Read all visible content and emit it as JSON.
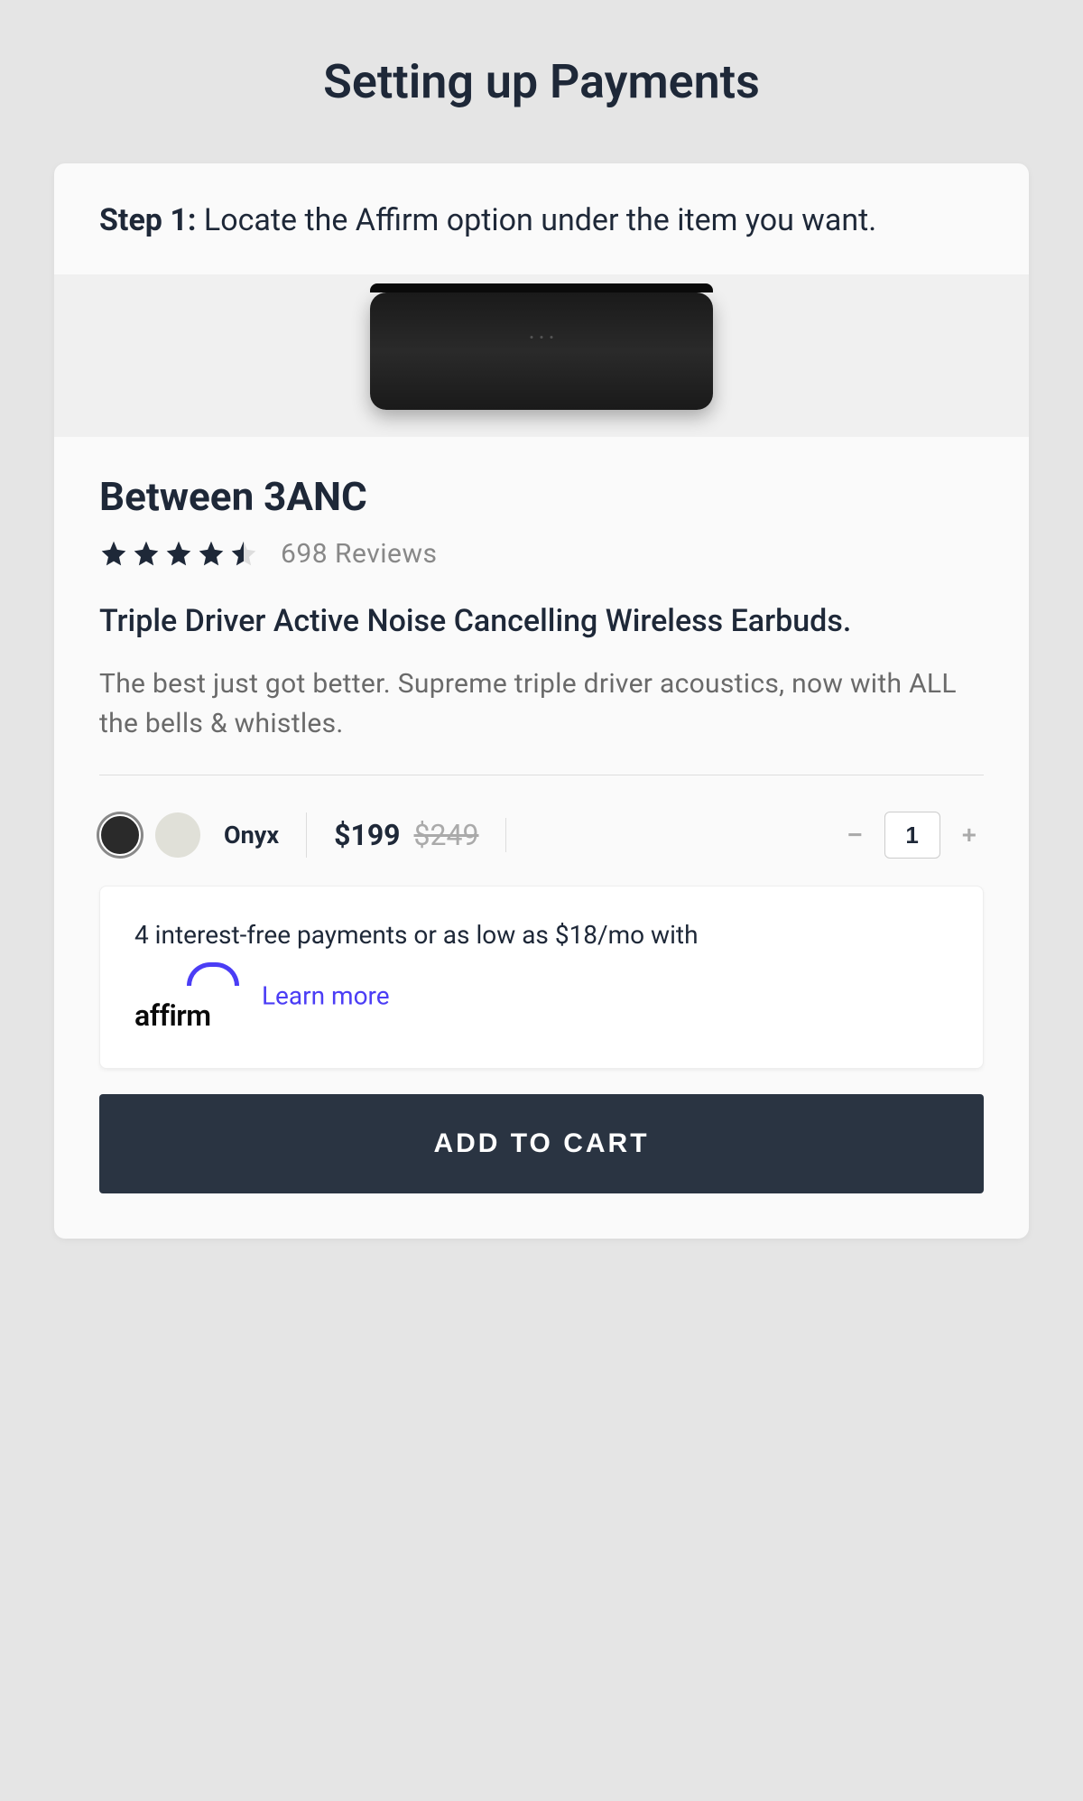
{
  "page": {
    "title": "Setting up Payments",
    "step_label": "Step 1:",
    "step_text": "Locate the Affirm option under the item you want."
  },
  "product": {
    "name": "Between 3ANC",
    "rating": 4.5,
    "review_count": "698 Reviews",
    "subtitle": "Triple Driver Active Noise Cancelling Wireless Earbuds.",
    "description": "The best just got better. Supreme triple driver acoustics, now with ALL the bells & whistles.",
    "colors": {
      "selected_name": "Onyx"
    },
    "price": {
      "current": "$199",
      "old": "$249"
    },
    "quantity": "1"
  },
  "affirm": {
    "text": "4 interest-free payments or as low as $18/mo with",
    "logo_text": "affirm",
    "learn_more": "Learn more"
  },
  "cart": {
    "button_label": "ADD TO CART"
  }
}
